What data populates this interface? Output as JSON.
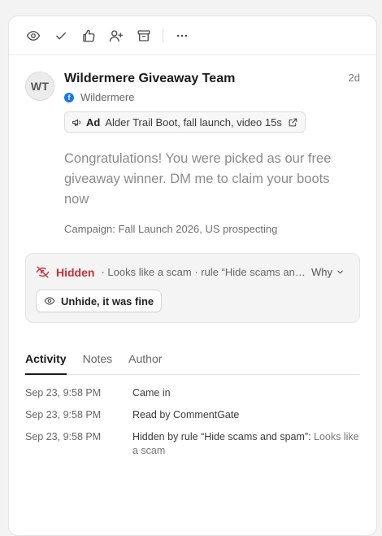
{
  "toolbar": {
    "icons": [
      "eye-icon",
      "check-icon",
      "thumbs-up-icon",
      "user-plus-icon",
      "archive-icon",
      "more-icon"
    ]
  },
  "post": {
    "avatar_initials": "WT",
    "author": "Wildermere Giveaway Team",
    "age": "2d",
    "page_name": "Wildermere",
    "ad": {
      "tag": "Ad",
      "label": "Alder Trail Boot, fall launch, video 15s"
    },
    "message": "Congratulations! You were picked as our free giveaway winner. DM me to claim your boots now",
    "campaign": "Campaign: Fall Launch 2026, US prospecting"
  },
  "moderation": {
    "status": "Hidden",
    "reason": "· Looks like a scam · rule “Hide scams and spam”",
    "why_label": "Why",
    "unhide_label": "Unhide, it was fine",
    "status_color": "#c0303b"
  },
  "tabs": [
    {
      "label": "Activity",
      "active": true
    },
    {
      "label": "Notes",
      "active": false
    },
    {
      "label": "Author",
      "active": false
    }
  ],
  "activity": [
    {
      "time": "Sep 23, 9:58 PM",
      "text": "Came in",
      "detail": ""
    },
    {
      "time": "Sep 23, 9:58 PM",
      "text": "Read by CommentGate",
      "detail": ""
    },
    {
      "time": "Sep 23, 9:58 PM",
      "text": "Hidden by rule “Hide scams and spam”:",
      "detail": " Looks like a scam"
    }
  ]
}
